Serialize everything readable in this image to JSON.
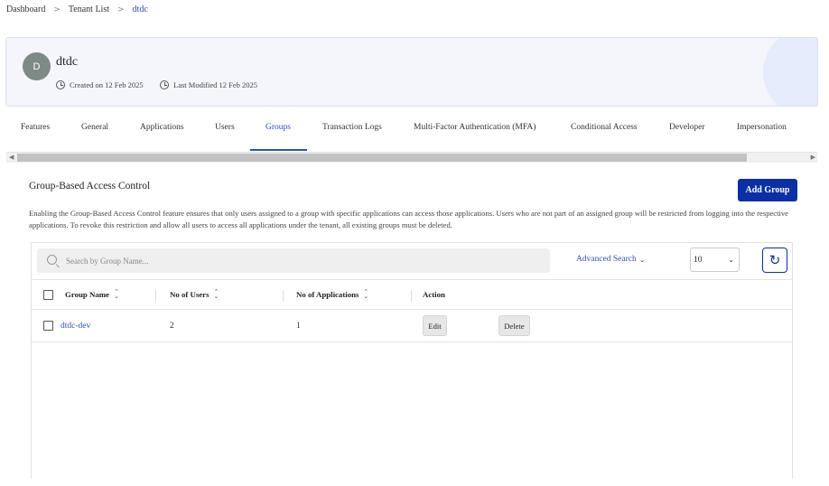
{
  "breadcrumb": {
    "items": [
      "Dashboard",
      "Tenant List",
      "dtdc"
    ],
    "separator": ">"
  },
  "tenant": {
    "avatar_letter": "D",
    "name": "dtdc",
    "created": "Created on 12 Feb 2025",
    "modified": "Last Modified 12 Feb 2025",
    "avatar_color": "#7d8a86"
  },
  "tabs": [
    {
      "label": "Features"
    },
    {
      "label": "General"
    },
    {
      "label": "Applications"
    },
    {
      "label": "Users"
    },
    {
      "label": "Groups",
      "active": true
    },
    {
      "label": "Transaction Logs"
    },
    {
      "label": "Multi-Factor Authentication (MFA)"
    },
    {
      "label": "Conditional Access"
    },
    {
      "label": "Developer"
    },
    {
      "label": "Impersonation"
    }
  ],
  "section": {
    "title": "Group-Based Access Control",
    "add_button": "Add Group",
    "description": "Enabling the Group-Based Access Control feature ensures that only users assigned to a group with specific applications can access those applications. Users who are not part of an assigned group will be restricted from logging into the respective applications. To revoke this restriction and allow all users to access all applications under the tenant, all existing groups must be deleted."
  },
  "toolbar": {
    "search_placeholder": "Search by Group Name...",
    "advanced_search": "Advanced Search",
    "page_size": "10"
  },
  "table": {
    "columns": [
      "Group Name",
      "No of Users",
      "No of Applications",
      "Action"
    ],
    "rows": [
      {
        "group_name": "dtdc-dev",
        "users": "2",
        "applications": "1",
        "edit": "Edit",
        "delete": "Delete"
      }
    ]
  },
  "colors": {
    "accent": "#0b2fa6",
    "link": "#2b4fbf"
  }
}
